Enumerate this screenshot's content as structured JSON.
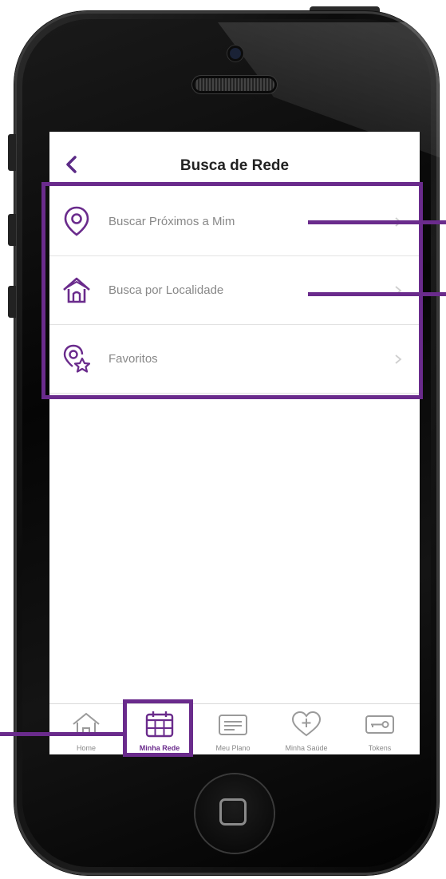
{
  "header": {
    "title": "Busca de Rede"
  },
  "menu": [
    {
      "label": "Buscar Próximos a Mim",
      "icon": "location-pin-icon"
    },
    {
      "label": "Busca por Localidade",
      "icon": "house-icon"
    },
    {
      "label": "Favoritos",
      "icon": "pin-star-icon"
    }
  ],
  "tabs": [
    {
      "label": "Home",
      "icon": "home-icon"
    },
    {
      "label": "Minha Rede",
      "icon": "calendar-grid-icon"
    },
    {
      "label": "Meu Plano",
      "icon": "card-icon"
    },
    {
      "label": "Minha Saúde",
      "icon": "heart-plus-icon"
    },
    {
      "label": "Tokens",
      "icon": "key-icon"
    }
  ],
  "colors": {
    "accent": "#6a2b8c",
    "text": "#222222",
    "muted": "#888888"
  }
}
